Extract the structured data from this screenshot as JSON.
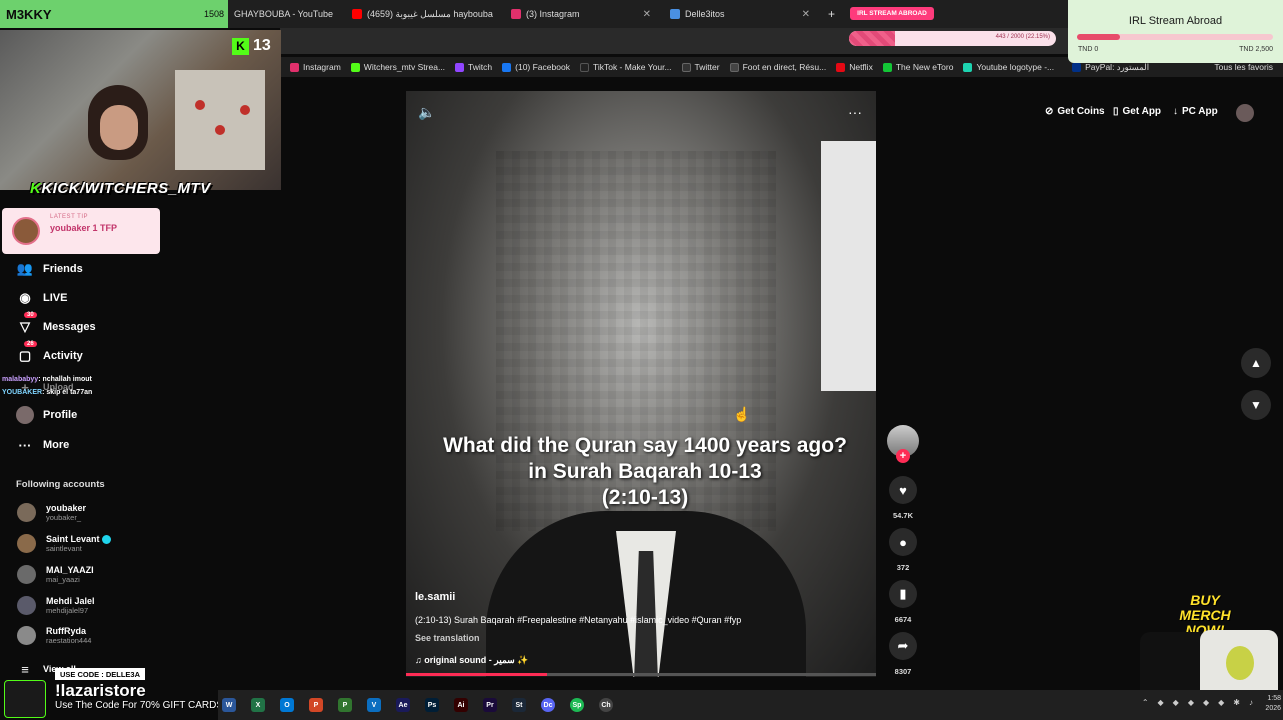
{
  "streamer": {
    "name": "M3KKY",
    "viewer_count": "1508",
    "kick_viewers": "13",
    "kick_handle": "KICK/WITCHERS_MTV"
  },
  "browser": {
    "tabs": [
      {
        "label": "GHAYBOUBA - YouTube",
        "color": "#ff0000"
      },
      {
        "label": "مسلسل غيبوبة (4659) haybouba",
        "color": "#ff0000"
      },
      {
        "label": "(3) Instagram",
        "color": "#e1306c"
      },
      {
        "label": "Delle3itos",
        "color": "#4a90e2"
      }
    ],
    "new_tab": "+",
    "bookmarks": [
      {
        "label": "Instagram",
        "color": "#e1306c"
      },
      {
        "label": "Witchers_mtv Strea...",
        "color": "#53fc18"
      },
      {
        "label": "Twitch",
        "color": "#9146ff"
      },
      {
        "label": "(10) Facebook",
        "color": "#1877f2"
      },
      {
        "label": "TikTok - Make Your...",
        "color": "#222222"
      },
      {
        "label": "Twitter",
        "color": "#333333"
      },
      {
        "label": "Foot en direct, Résu...",
        "color": "#444444"
      },
      {
        "label": "Netflix",
        "color": "#e50914"
      },
      {
        "label": "The New eToro",
        "color": "#13c636"
      },
      {
        "label": "Youtube logotype -...",
        "color": "#1dd3b0"
      },
      {
        "label": "PayPal: المستورد",
        "color": "#003087"
      }
    ],
    "all_favorites": "Tous les favoris"
  },
  "tip": {
    "label": "LATEST TIP",
    "value": "youbaker 1 TFP"
  },
  "sidebar": {
    "friends": "Friends",
    "live": "LIVE",
    "messages": "Messages",
    "messages_badge": "30",
    "activity": "Activity",
    "activity_badge": "26",
    "upload": "Upload",
    "profile": "Profile",
    "more": "More",
    "following_title": "Following accounts",
    "accounts": [
      {
        "name": "youbaker",
        "handle": "youbaker_",
        "verified": false,
        "color": "#7a6a5a"
      },
      {
        "name": "Saint Levant",
        "handle": "saintlevant",
        "verified": true,
        "color": "#8a6a4a"
      },
      {
        "name": "MAI_YAAZI",
        "handle": "mai_yaazi",
        "verified": false,
        "color": "#6a6a6a"
      },
      {
        "name": "Mehdi Jalel",
        "handle": "mehdijalel97",
        "verified": false,
        "color": "#5a5a6a"
      },
      {
        "name": "RuffRyda",
        "handle": "raestation444",
        "verified": false,
        "color": "#8a8a8a"
      }
    ],
    "view_all": "View all"
  },
  "chat": [
    {
      "user": "malababyy",
      "msg": ": nchallah imout"
    },
    {
      "user": "YOUBAKER",
      "msg": ": skip el ta77an"
    }
  ],
  "tiktok_header": {
    "get_coins": "Get Coins",
    "get_app": "Get App",
    "pc_app": "PC App"
  },
  "video": {
    "caption_line1": "What did the Quran say 1400 years ago?",
    "caption_line2": "in Surah Baqarah 10-13",
    "caption_line3": "(2:10-13)",
    "author": "le.samii",
    "description": "(2:10-13) Surah Baqarah #Freepalestine #Netanyahu #islamic_video #Quran #fyp",
    "see_translation": "See translation",
    "sound": "original sound - سمير ✨",
    "progress": 0.3,
    "likes": "54.7K",
    "comments": "372",
    "saves": "6674",
    "shares": "8307"
  },
  "goal": {
    "pill": "IRL STREAM ABROAD",
    "title": "IRL Stream Abroad",
    "bar_text": "443 / 2000 (22.15%)",
    "bar_fill": 0.22,
    "min": "TND 0",
    "max": "TND 2,500",
    "card_fill": 0.22
  },
  "merch": {
    "line1": "BUY MERCH",
    "line2": "NOW!"
  },
  "promo": {
    "code": "USE CODE : DELLE3A",
    "title": "!lazaristore",
    "sub": "Use The Code For 70% GIFT CARDS"
  },
  "taskbar": {
    "apps": [
      {
        "label": "W",
        "color": "#2b579a"
      },
      {
        "label": "X",
        "color": "#217346"
      },
      {
        "label": "O",
        "color": "#0078d4"
      },
      {
        "label": "P",
        "color": "#d24726"
      },
      {
        "label": "P",
        "color": "#31752f"
      },
      {
        "label": "V",
        "color": "#0b6ec0"
      },
      {
        "label": "Ae",
        "color": "#1a1a5a"
      },
      {
        "label": "Ps",
        "color": "#001e36"
      },
      {
        "label": "Ai",
        "color": "#330000"
      },
      {
        "label": "Pr",
        "color": "#1a0a3a"
      },
      {
        "label": "St",
        "color": "#1b2838"
      },
      {
        "label": "Dc",
        "color": "#5865f2"
      },
      {
        "label": "Sp",
        "color": "#1db954"
      },
      {
        "label": "Ch",
        "color": "#444444"
      }
    ],
    "time": "1:58",
    "date": "2026"
  }
}
